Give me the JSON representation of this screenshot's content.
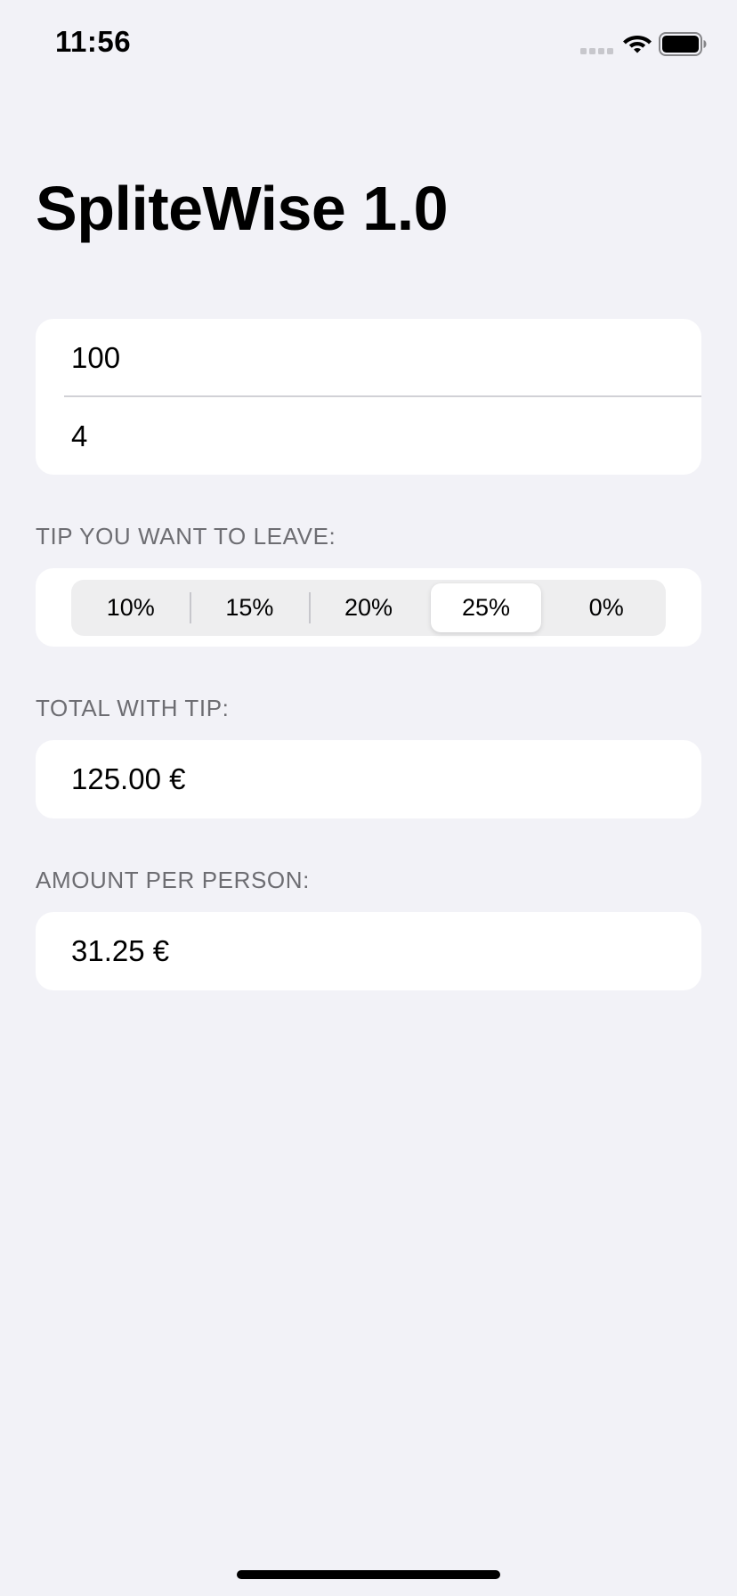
{
  "status_bar": {
    "time": "11:56",
    "icons": [
      "cellular-signal-icon",
      "wifi-icon",
      "battery-icon"
    ]
  },
  "app": {
    "title": "SpliteWise 1.0"
  },
  "inputs": {
    "amount_value": "100",
    "people_value": "4"
  },
  "tip_section": {
    "header": "TIP YOU WANT TO LEAVE:",
    "options": [
      "10%",
      "15%",
      "20%",
      "25%",
      "0%"
    ],
    "selected": "25%"
  },
  "total_section": {
    "header": "TOTAL WITH TIP:",
    "value": "125.00 €"
  },
  "per_person_section": {
    "header": "AMOUNT PER PERSON:",
    "value": "31.25 €"
  },
  "colors": {
    "background": "#F2F2F7",
    "card": "#FFFFFF",
    "section_header": "#6D6D72",
    "segment_track": "#EEEEEF"
  }
}
